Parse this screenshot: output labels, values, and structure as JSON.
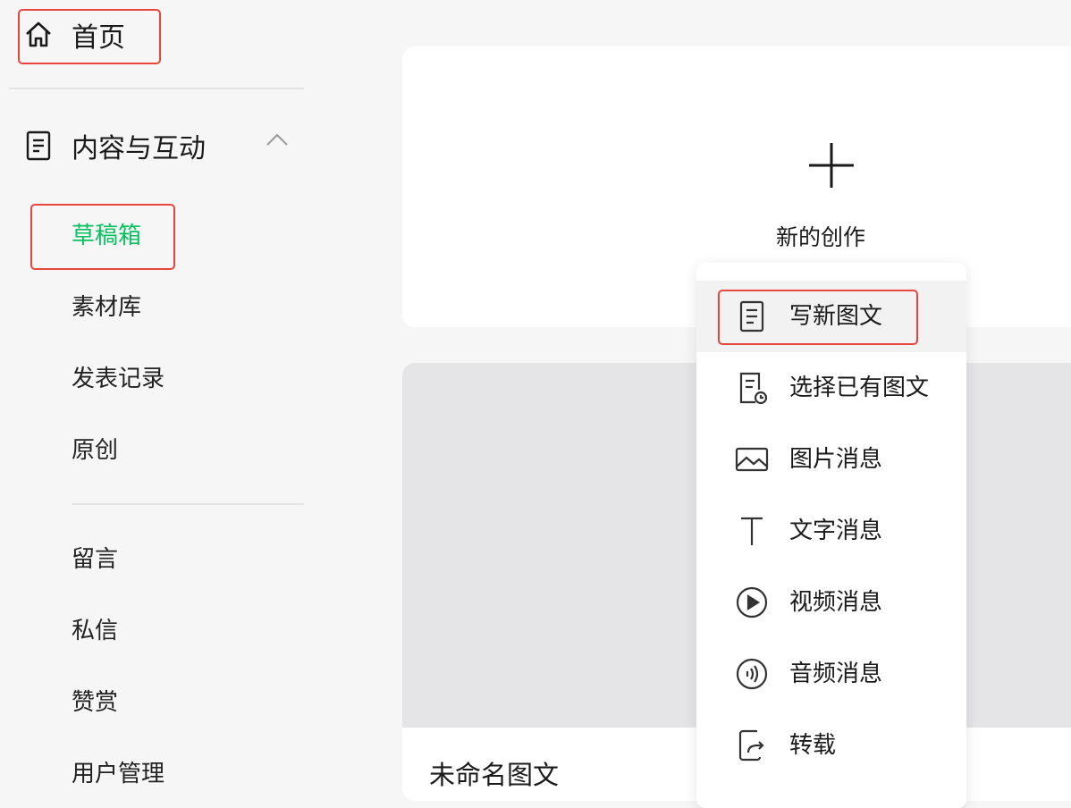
{
  "sidebar": {
    "home_label": "首页",
    "section_label": "内容与互动",
    "sub_items": [
      "草稿箱",
      "素材库",
      "发表记录",
      "原创"
    ],
    "more_items": [
      "留言",
      "私信",
      "赞赏",
      "用户管理"
    ]
  },
  "main": {
    "new_creation_label": "新的创作",
    "draft_title": "未命名图文"
  },
  "dropdown": {
    "items": [
      {
        "label": "写新图文",
        "icon": "doc-icon"
      },
      {
        "label": "选择已有图文",
        "icon": "doc-clock-icon"
      },
      {
        "label": "图片消息",
        "icon": "image-icon"
      },
      {
        "label": "文字消息",
        "icon": "text-icon"
      },
      {
        "label": "视频消息",
        "icon": "play-circle-icon"
      },
      {
        "label": "音频消息",
        "icon": "audio-icon"
      },
      {
        "label": "转载",
        "icon": "share-doc-icon"
      }
    ]
  },
  "colors": {
    "accent_green": "#07c160",
    "highlight_red": "#e8453c",
    "background": "#f6f6f7"
  }
}
